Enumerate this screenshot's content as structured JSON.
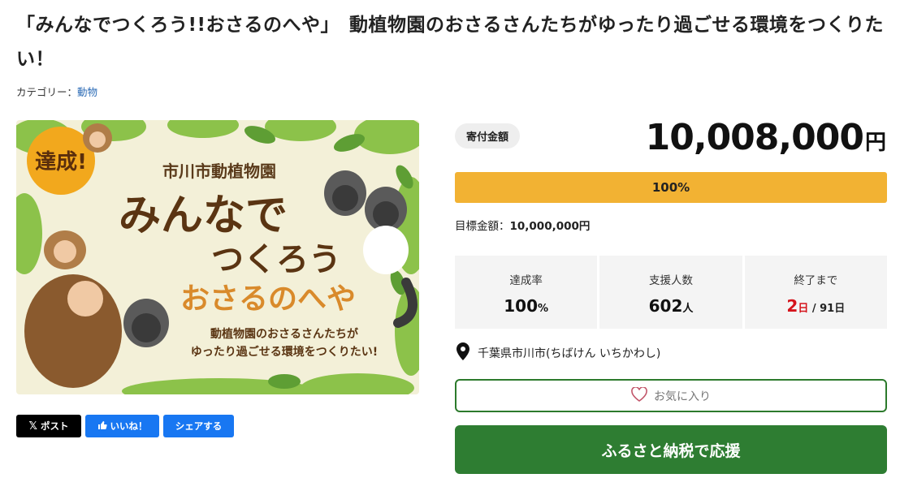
{
  "page": {
    "title": "「みんなでつくろう!!おさるのへや」　動植物園のおさるさんたちがゆったり過ごせる環境をつくりたい！",
    "category_label": "カテゴリー：",
    "category_value": "動物"
  },
  "hero": {
    "badge": "達成!",
    "zoo_name": "市川市動植物園",
    "line1": "みんなで",
    "line2": "つくろう",
    "line3": "おさるのへや",
    "sub1": "動植物園のおさるさんたちが",
    "sub2": "ゆったり過ごせる環境をつくりたい!"
  },
  "share": {
    "x_label": "ポスト",
    "like_label": "いいね！",
    "share_label": "シェアする"
  },
  "funding": {
    "amount_label": "寄付金額",
    "amount": "10,008,000",
    "amount_unit": "円",
    "progress_text": "100%",
    "progress_fraction": 1.0,
    "target_label": "目標金額：",
    "target_value": "10,000,000円"
  },
  "stats": {
    "rate_label": "達成率",
    "rate_value": "100",
    "rate_unit": "%",
    "supporters_label": "支援人数",
    "supporters_value": "602",
    "supporters_unit": "人",
    "remaining_label": "終了まで",
    "remaining_value": "2",
    "remaining_unit": "日",
    "remaining_total": " / 91日"
  },
  "location": {
    "text": "千葉県市川市(ちばけん いちかわし)"
  },
  "buttons": {
    "favorite": "お気に入り",
    "donate": "ふるさと納税で応援"
  },
  "colors": {
    "progress": "#f2b233",
    "donate": "#2e7d32",
    "red": "#d5141c"
  }
}
